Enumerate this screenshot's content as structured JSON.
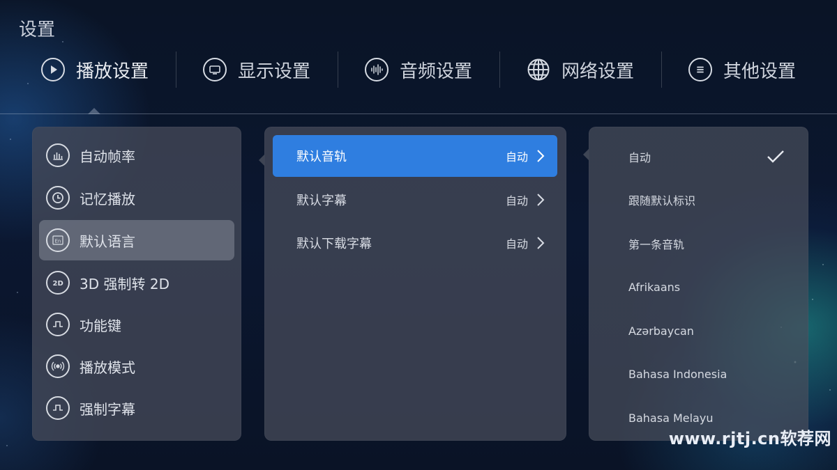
{
  "page": {
    "title": "设置"
  },
  "tabs": [
    {
      "label": "播放设置",
      "icon": "play-icon"
    },
    {
      "label": "显示设置",
      "icon": "monitor-icon"
    },
    {
      "label": "音频设置",
      "icon": "audio-wave-icon"
    },
    {
      "label": "网络设置",
      "icon": "globe-icon"
    },
    {
      "label": "其他设置",
      "icon": "menu-icon"
    }
  ],
  "left_menu": [
    {
      "label": "自动帧率",
      "icon": "bar-chart-icon"
    },
    {
      "label": "记忆播放",
      "icon": "clock-icon"
    },
    {
      "label": "默认语言",
      "icon": "language-en-icon"
    },
    {
      "label": "3D 强制转 2D",
      "icon": "2d-icon"
    },
    {
      "label": "功能键",
      "icon": "pulse-key-icon"
    },
    {
      "label": "播放模式",
      "icon": "broadcast-icon"
    },
    {
      "label": "强制字幕",
      "icon": "subtitle-pulse-icon"
    }
  ],
  "middle_menu": [
    {
      "label": "默认音轨",
      "value": "自动"
    },
    {
      "label": "默认字幕",
      "value": "自动"
    },
    {
      "label": "默认下载字幕",
      "value": "自动"
    }
  ],
  "right_options": [
    {
      "label": "自动",
      "checked": true
    },
    {
      "label": "跟随默认标识"
    },
    {
      "label": "第一条音轨"
    },
    {
      "label": "Afrikaans"
    },
    {
      "label": "Azərbaycan"
    },
    {
      "label": "Bahasa Indonesia"
    },
    {
      "label": "Bahasa Melayu"
    }
  ],
  "watermark": "www.rjtj.cn软荐网",
  "colors": {
    "accent": "#2f7ee0",
    "panel": "#444958"
  }
}
